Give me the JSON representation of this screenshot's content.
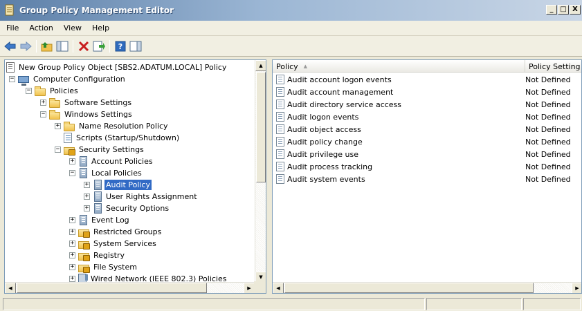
{
  "window": {
    "title": "Group Policy Management Editor",
    "controls": [
      "_",
      "□",
      "X"
    ]
  },
  "menu": [
    "File",
    "Action",
    "View",
    "Help"
  ],
  "toolbar": {
    "buttons": [
      "back-arrow-icon",
      "forward-arrow-icon",
      "up-folder-icon",
      "show-hide-tree-icon",
      "delete-icon",
      "export-list-icon",
      "help-icon",
      "properties-pane-icon"
    ]
  },
  "tree": {
    "root": "New Group Policy Object [SBS2.ADATUM.LOCAL] Policy",
    "computer_config": "Computer Configuration",
    "policies": "Policies",
    "software_settings": "Software Settings",
    "windows_settings": "Windows Settings",
    "name_resolution": "Name Resolution Policy",
    "scripts": "Scripts (Startup/Shutdown)",
    "security_settings": "Security Settings",
    "account_policies": "Account Policies",
    "local_policies": "Local Policies",
    "audit_policy": "Audit Policy",
    "user_rights": "User Rights Assignment",
    "security_options": "Security Options",
    "event_log": "Event Log",
    "restricted_groups": "Restricted Groups",
    "system_services": "System Services",
    "registry": "Registry",
    "file_system": "File System",
    "wired_network": "Wired Network (IEEE 802.3) Policies"
  },
  "list": {
    "columns": {
      "policy": "Policy",
      "setting": "Policy Setting"
    },
    "rows": [
      {
        "policy": "Audit account logon events",
        "setting": "Not Defined"
      },
      {
        "policy": "Audit account management",
        "setting": "Not Defined"
      },
      {
        "policy": "Audit directory service access",
        "setting": "Not Defined"
      },
      {
        "policy": "Audit logon events",
        "setting": "Not Defined"
      },
      {
        "policy": "Audit object access",
        "setting": "Not Defined"
      },
      {
        "policy": "Audit policy change",
        "setting": "Not Defined"
      },
      {
        "policy": "Audit privilege use",
        "setting": "Not Defined"
      },
      {
        "policy": "Audit process tracking",
        "setting": "Not Defined"
      },
      {
        "policy": "Audit system events",
        "setting": "Not Defined"
      }
    ]
  },
  "expander": {
    "plus": "+",
    "minus": "−"
  },
  "colors": {
    "selection": "#316ac5",
    "titlebar_start": "#5c7fa8"
  }
}
